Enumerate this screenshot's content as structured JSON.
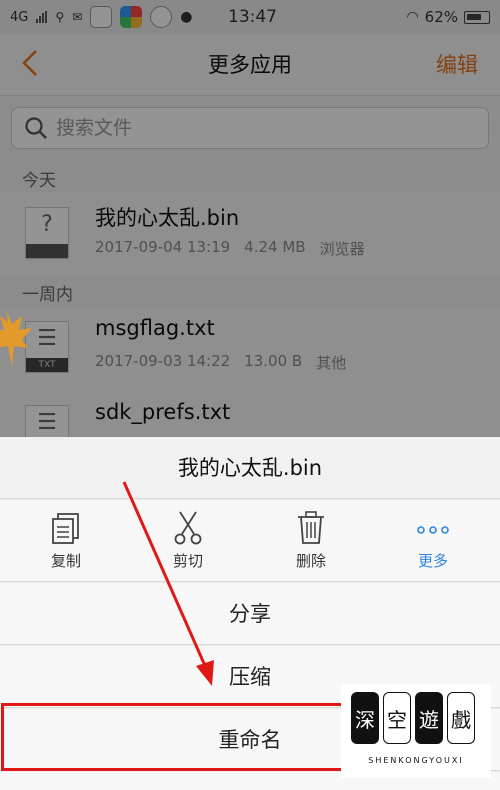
{
  "status_bar": {
    "network": "4G",
    "time": "13:47",
    "battery": "62%"
  },
  "nav": {
    "title": "更多应用",
    "edit": "编辑"
  },
  "search": {
    "placeholder": "搜索文件"
  },
  "sections": {
    "today": "今天",
    "week": "一周内"
  },
  "files": [
    {
      "name": "我的心太乱.bin",
      "date": "2017-09-04 13:19",
      "size": "4.24 MB",
      "source": "浏览器",
      "icon": "unknown-file-icon"
    },
    {
      "name": "msgflag.txt",
      "date": "2017-09-03 14:22",
      "size": "13.00 B",
      "source": "其他",
      "icon": "txt-file-icon",
      "badge": "TXT"
    },
    {
      "name": "sdk_prefs.txt",
      "icon": "txt-file-icon"
    }
  ],
  "sheet": {
    "title": "我的心太乱.bin",
    "actions": [
      {
        "label": "复制",
        "icon": "copy-icon"
      },
      {
        "label": "剪切",
        "icon": "scissors-icon"
      },
      {
        "label": "删除",
        "icon": "trash-icon"
      },
      {
        "label": "更多",
        "icon": "more-dots-icon"
      }
    ],
    "rows": [
      "分享",
      "压缩",
      "重命名"
    ]
  },
  "watermark": {
    "chars": [
      "深",
      "空",
      "遊",
      "戲"
    ],
    "sub": "SHENKONGYOUXI"
  },
  "colors": {
    "accent": "#e4701e",
    "link": "#2f86e0",
    "annotation": "#e01818"
  }
}
